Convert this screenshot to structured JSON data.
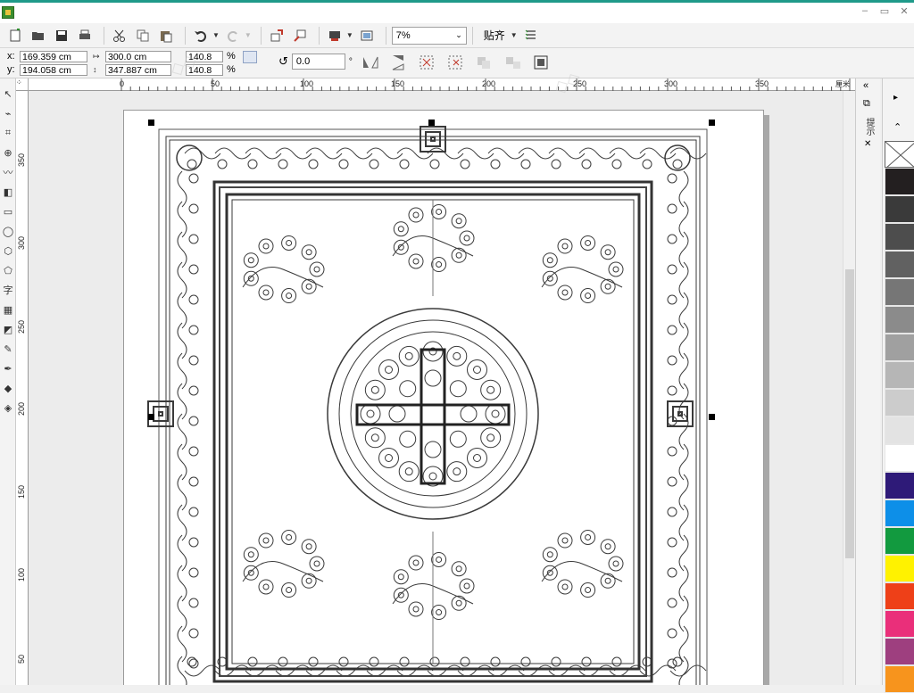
{
  "window": {
    "controls": [
      "minimize-icon",
      "restore-icon",
      "close-icon"
    ]
  },
  "toolbar": {
    "zoom_value": "7%",
    "snap_label": "贴齐"
  },
  "properties": {
    "x_label": "x:",
    "x_value": "169.359 cm",
    "y_label": "y:",
    "y_value": "194.058 cm",
    "width_value": "300.0 cm",
    "height_value": "347.887 cm",
    "scale_x": "140.8",
    "scale_y": "140.8",
    "percent": "%",
    "rotation_value": "0.0",
    "degree": "°"
  },
  "ruler": {
    "top_labels": [
      "0",
      "50",
      "100",
      "150",
      "200",
      "250",
      "300",
      "350"
    ],
    "left_labels": [
      "350",
      "300",
      "250",
      "200",
      "150",
      "100",
      "50"
    ],
    "unit": "厘米"
  },
  "toolbox": {
    "text_tool": "字"
  },
  "dock": {
    "tab_label": "提示"
  },
  "palette": {
    "colors": [
      "#231f20",
      "#3a3a3a",
      "#4d4d4d",
      "#616161",
      "#767676",
      "#8b8b8b",
      "#a0a0a0",
      "#b6b6b6",
      "#cccccc",
      "#e3e3e3",
      "#ffffff",
      "#2e1a78",
      "#0d8fe8",
      "#129a3f",
      "#fff200",
      "#ee4018",
      "#ea2f7a",
      "#9e3f7f",
      "#f7941d"
    ]
  }
}
